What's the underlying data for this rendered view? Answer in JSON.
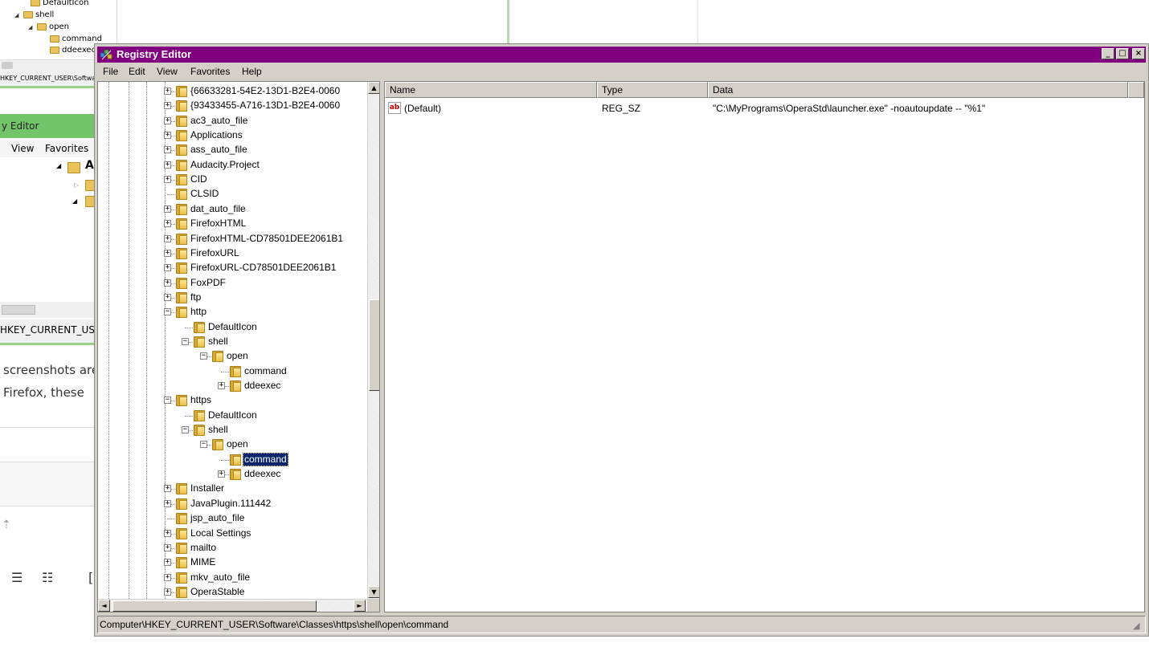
{
  "background": {
    "top_tree": [
      {
        "label": "DefaultIcon"
      },
      {
        "label": "shell"
      },
      {
        "label": "open"
      },
      {
        "label": "command"
      },
      {
        "label": "ddeexec"
      }
    ],
    "top_status": "HKEY_CURRENT_USER\\Software",
    "win2": {
      "title": "y Editor",
      "menu": [
        "View",
        "Favorites"
      ],
      "tree_letter": "A",
      "status": "HKEY_CURRENT_US"
    },
    "doc": {
      "line1": "screenshots are",
      "line2": "Firefox, these"
    }
  },
  "window": {
    "title": "Registry Editor",
    "caption_buttons": {
      "minimize": "_",
      "maximize": "□",
      "close": "×"
    },
    "menu": [
      "File",
      "Edit",
      "View",
      "Favorites",
      "Help"
    ]
  },
  "tree": {
    "nodes": [
      {
        "label": "{66633281-54E2-13D1-B2E4-0060",
        "expander": "+"
      },
      {
        "label": "{93433455-A716-13D1-B2E4-0060",
        "expander": "+"
      },
      {
        "label": "ac3_auto_file",
        "expander": "+"
      },
      {
        "label": "Applications",
        "expander": "+"
      },
      {
        "label": "ass_auto_file",
        "expander": "+"
      },
      {
        "label": "Audacity.Project",
        "expander": "+"
      },
      {
        "label": "CID",
        "expander": "+"
      },
      {
        "label": "CLSID",
        "expander": ""
      },
      {
        "label": "dat_auto_file",
        "expander": "+"
      },
      {
        "label": "FirefoxHTML",
        "expander": "+"
      },
      {
        "label": "FirefoxHTML-CD78501DEE2061B1",
        "expander": "+"
      },
      {
        "label": "FirefoxURL",
        "expander": "+"
      },
      {
        "label": "FirefoxURL-CD78501DEE2061B1",
        "expander": "+"
      },
      {
        "label": "FoxPDF",
        "expander": "+"
      },
      {
        "label": "ftp",
        "expander": "+"
      },
      {
        "label": "http",
        "expander": "−"
      },
      {
        "label": "DefaultIcon",
        "expander": ""
      },
      {
        "label": "shell",
        "expander": "−"
      },
      {
        "label": "open",
        "expander": "−"
      },
      {
        "label": "command",
        "expander": ""
      },
      {
        "label": "ddeexec",
        "expander": "+"
      },
      {
        "label": "https",
        "expander": "−"
      },
      {
        "label": "DefaultIcon",
        "expander": ""
      },
      {
        "label": "shell",
        "expander": "−"
      },
      {
        "label": "open",
        "expander": "−"
      },
      {
        "label": "command",
        "expander": "",
        "selected": true
      },
      {
        "label": "ddeexec",
        "expander": "+"
      },
      {
        "label": "Installer",
        "expander": "+"
      },
      {
        "label": "JavaPlugin.111442",
        "expander": "+"
      },
      {
        "label": "jsp_auto_file",
        "expander": ""
      },
      {
        "label": "Local Settings",
        "expander": "+"
      },
      {
        "label": "mailto",
        "expander": "+"
      },
      {
        "label": "MIME",
        "expander": "+"
      },
      {
        "label": "mkv_auto_file",
        "expander": "+"
      },
      {
        "label": "OperaStable",
        "expander": "+"
      }
    ],
    "scroll_arrows": {
      "up": "▲",
      "down": "▼",
      "left": "◄",
      "right": "►"
    }
  },
  "list": {
    "columns": [
      "Name",
      "Type",
      "Data"
    ],
    "rows": [
      {
        "icon": "ab",
        "name": "(Default)",
        "type": "REG_SZ",
        "data": "\"C:\\MyPrograms\\OperaStd\\launcher.exe\" -noautoupdate -- \"%1\""
      }
    ]
  },
  "status": {
    "path": "Computer\\HKEY_CURRENT_USER\\Software\\Classes\\https\\shell\\open\\command",
    "grip": "◢"
  },
  "colors": {
    "titlebar": "#800080",
    "selection": "#0a246a",
    "chrome": "#d4d0c8",
    "background_green": "#74c46a"
  }
}
